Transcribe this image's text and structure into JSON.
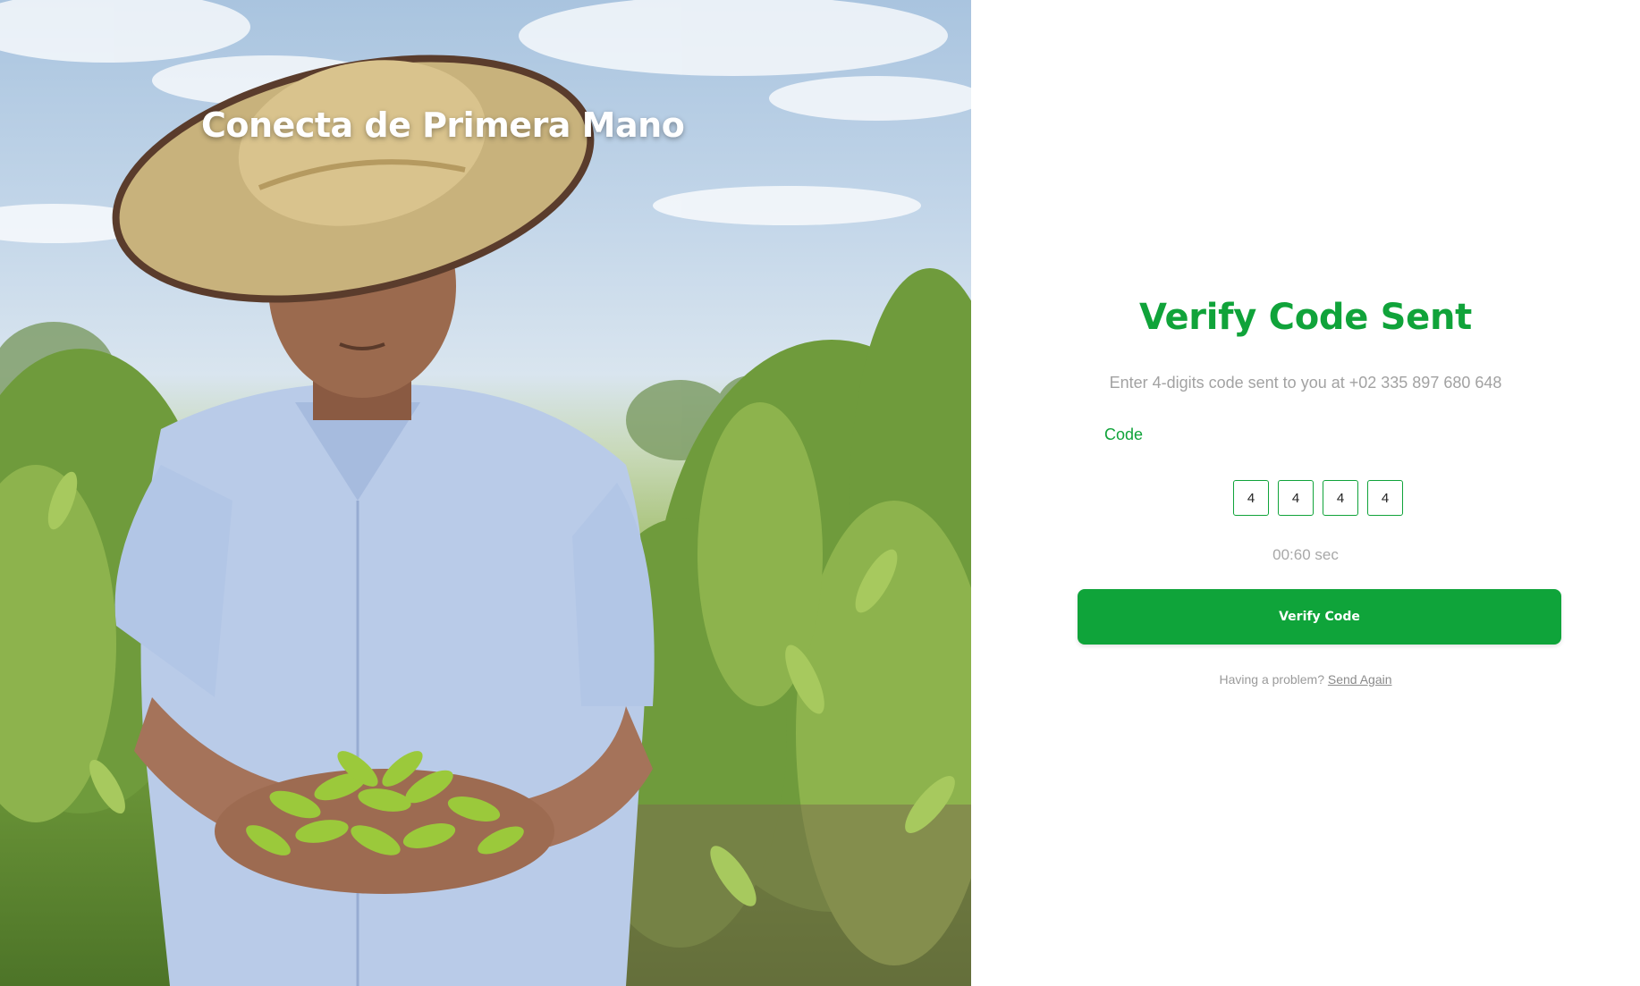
{
  "hero": {
    "title": "Conecta de Primera Mano",
    "photo": "farmer-holding-green-beans"
  },
  "verify": {
    "heading": "Verify Code Sent",
    "subtext": "Enter 4-digits code sent to you at +02 335 897 680 648",
    "code_label": "Code",
    "digits": [
      "4",
      "4",
      "4",
      "4"
    ],
    "timer": "00:60 sec",
    "button_label": "Verify Code",
    "help_text": "Having a problem?",
    "help_link": "Send Again"
  },
  "colors": {
    "accent": "#10a33a",
    "button": "#0fa43a",
    "muted_text": "#a2a2a2"
  }
}
